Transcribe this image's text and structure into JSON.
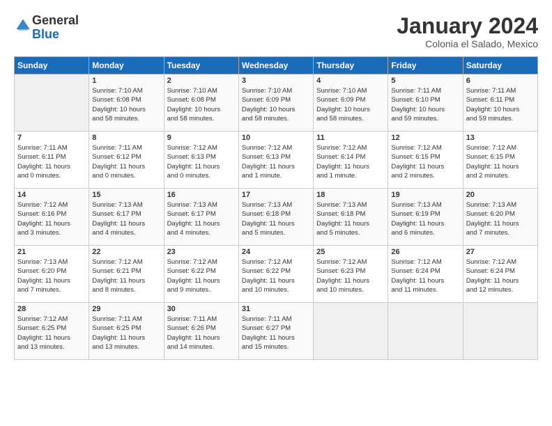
{
  "logo": {
    "general": "General",
    "blue": "Blue"
  },
  "header": {
    "month": "January 2024",
    "location": "Colonia el Salado, Mexico"
  },
  "weekdays": [
    "Sunday",
    "Monday",
    "Tuesday",
    "Wednesday",
    "Thursday",
    "Friday",
    "Saturday"
  ],
  "weeks": [
    [
      {
        "day": "",
        "info": ""
      },
      {
        "day": "1",
        "info": "Sunrise: 7:10 AM\nSunset: 6:08 PM\nDaylight: 10 hours\nand 58 minutes."
      },
      {
        "day": "2",
        "info": "Sunrise: 7:10 AM\nSunset: 6:08 PM\nDaylight: 10 hours\nand 58 minutes."
      },
      {
        "day": "3",
        "info": "Sunrise: 7:10 AM\nSunset: 6:09 PM\nDaylight: 10 hours\nand 58 minutes."
      },
      {
        "day": "4",
        "info": "Sunrise: 7:10 AM\nSunset: 6:09 PM\nDaylight: 10 hours\nand 58 minutes."
      },
      {
        "day": "5",
        "info": "Sunrise: 7:11 AM\nSunset: 6:10 PM\nDaylight: 10 hours\nand 59 minutes."
      },
      {
        "day": "6",
        "info": "Sunrise: 7:11 AM\nSunset: 6:11 PM\nDaylight: 10 hours\nand 59 minutes."
      }
    ],
    [
      {
        "day": "7",
        "info": "Sunrise: 7:11 AM\nSunset: 6:11 PM\nDaylight: 11 hours\nand 0 minutes."
      },
      {
        "day": "8",
        "info": "Sunrise: 7:11 AM\nSunset: 6:12 PM\nDaylight: 11 hours\nand 0 minutes."
      },
      {
        "day": "9",
        "info": "Sunrise: 7:12 AM\nSunset: 6:13 PM\nDaylight: 11 hours\nand 0 minutes."
      },
      {
        "day": "10",
        "info": "Sunrise: 7:12 AM\nSunset: 6:13 PM\nDaylight: 11 hours\nand 1 minute."
      },
      {
        "day": "11",
        "info": "Sunrise: 7:12 AM\nSunset: 6:14 PM\nDaylight: 11 hours\nand 1 minute."
      },
      {
        "day": "12",
        "info": "Sunrise: 7:12 AM\nSunset: 6:15 PM\nDaylight: 11 hours\nand 2 minutes."
      },
      {
        "day": "13",
        "info": "Sunrise: 7:12 AM\nSunset: 6:15 PM\nDaylight: 11 hours\nand 2 minutes."
      }
    ],
    [
      {
        "day": "14",
        "info": "Sunrise: 7:12 AM\nSunset: 6:16 PM\nDaylight: 11 hours\nand 3 minutes."
      },
      {
        "day": "15",
        "info": "Sunrise: 7:13 AM\nSunset: 6:17 PM\nDaylight: 11 hours\nand 4 minutes."
      },
      {
        "day": "16",
        "info": "Sunrise: 7:13 AM\nSunset: 6:17 PM\nDaylight: 11 hours\nand 4 minutes."
      },
      {
        "day": "17",
        "info": "Sunrise: 7:13 AM\nSunset: 6:18 PM\nDaylight: 11 hours\nand 5 minutes."
      },
      {
        "day": "18",
        "info": "Sunrise: 7:13 AM\nSunset: 6:18 PM\nDaylight: 11 hours\nand 5 minutes."
      },
      {
        "day": "19",
        "info": "Sunrise: 7:13 AM\nSunset: 6:19 PM\nDaylight: 11 hours\nand 6 minutes."
      },
      {
        "day": "20",
        "info": "Sunrise: 7:13 AM\nSunset: 6:20 PM\nDaylight: 11 hours\nand 7 minutes."
      }
    ],
    [
      {
        "day": "21",
        "info": "Sunrise: 7:13 AM\nSunset: 6:20 PM\nDaylight: 11 hours\nand 7 minutes."
      },
      {
        "day": "22",
        "info": "Sunrise: 7:12 AM\nSunset: 6:21 PM\nDaylight: 11 hours\nand 8 minutes."
      },
      {
        "day": "23",
        "info": "Sunrise: 7:12 AM\nSunset: 6:22 PM\nDaylight: 11 hours\nand 9 minutes."
      },
      {
        "day": "24",
        "info": "Sunrise: 7:12 AM\nSunset: 6:22 PM\nDaylight: 11 hours\nand 10 minutes."
      },
      {
        "day": "25",
        "info": "Sunrise: 7:12 AM\nSunset: 6:23 PM\nDaylight: 11 hours\nand 10 minutes."
      },
      {
        "day": "26",
        "info": "Sunrise: 7:12 AM\nSunset: 6:24 PM\nDaylight: 11 hours\nand 11 minutes."
      },
      {
        "day": "27",
        "info": "Sunrise: 7:12 AM\nSunset: 6:24 PM\nDaylight: 11 hours\nand 12 minutes."
      }
    ],
    [
      {
        "day": "28",
        "info": "Sunrise: 7:12 AM\nSunset: 6:25 PM\nDaylight: 11 hours\nand 13 minutes."
      },
      {
        "day": "29",
        "info": "Sunrise: 7:11 AM\nSunset: 6:25 PM\nDaylight: 11 hours\nand 13 minutes."
      },
      {
        "day": "30",
        "info": "Sunrise: 7:11 AM\nSunset: 6:26 PM\nDaylight: 11 hours\nand 14 minutes."
      },
      {
        "day": "31",
        "info": "Sunrise: 7:11 AM\nSunset: 6:27 PM\nDaylight: 11 hours\nand 15 minutes."
      },
      {
        "day": "",
        "info": ""
      },
      {
        "day": "",
        "info": ""
      },
      {
        "day": "",
        "info": ""
      }
    ]
  ]
}
